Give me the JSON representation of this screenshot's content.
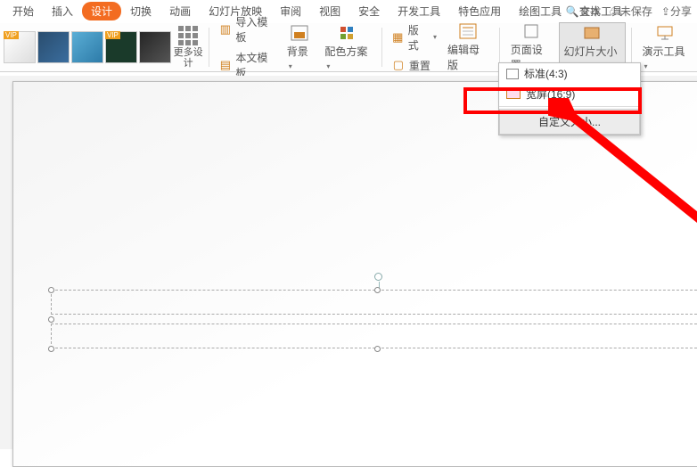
{
  "tabs": {
    "start": "开始",
    "insert": "插入",
    "design": "设计",
    "transition": "切换",
    "animation": "动画",
    "slideshow": "幻灯片放映",
    "review": "审阅",
    "view": "视图",
    "security": "安全",
    "devtools": "开发工具",
    "special": "特色应用",
    "drawtools": "绘图工具",
    "texttools": "文本工具"
  },
  "topright": {
    "search": "查找",
    "unsaved": "未保存",
    "share": "分享"
  },
  "ribbon": {
    "more_design": "更多设计",
    "import_tpl": "导入模板",
    "text_tpl": "本文模板",
    "background": "背景",
    "color_scheme": "配色方案",
    "layout": "版式",
    "reset": "重置",
    "edit_master": "编辑母版",
    "page_setup": "页面设置",
    "slide_size": "幻灯片大小",
    "present_tools": "演示工具"
  },
  "dropdown": {
    "standard": "标准(4:3)",
    "wide": "宽屏(16:9)",
    "custom": "自定义大小..."
  }
}
